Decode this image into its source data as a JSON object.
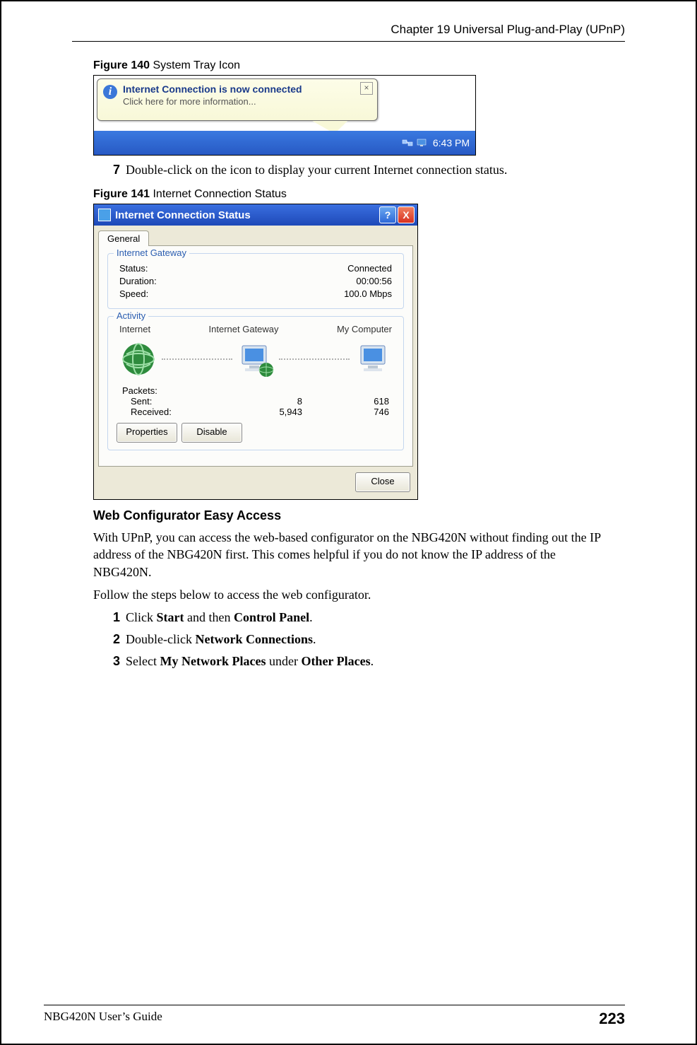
{
  "header": {
    "chapter": "Chapter 19 Universal Plug-and-Play (UPnP)"
  },
  "fig140": {
    "label_num": "Figure 140",
    "label_title": "   System Tray Icon",
    "balloon_title": "Internet Connection is now connected",
    "balloon_sub": "Click here for more information...",
    "clock": "6:43 PM"
  },
  "step7": {
    "num": "7",
    "text": "Double-click on the icon to display your current Internet connection status."
  },
  "fig141": {
    "label_num": "Figure 141",
    "label_title": "   Internet Connection Status",
    "window_title": "Internet Connection Status",
    "tab": "General",
    "group_gateway": "Internet Gateway",
    "status_label": "Status:",
    "status_value": "Connected",
    "duration_label": "Duration:",
    "duration_value": "00:00:56",
    "speed_label": "Speed:",
    "speed_value": "100.0 Mbps",
    "group_activity": "Activity",
    "col_internet": "Internet",
    "col_gateway": "Internet Gateway",
    "col_mycomputer": "My Computer",
    "packets_label": "Packets:",
    "sent_label": "Sent:",
    "received_label": "Received:",
    "sent_gw": "8",
    "sent_pc": "618",
    "recv_gw": "5,943",
    "recv_pc": "746",
    "btn_properties": "Properties",
    "btn_disable": "Disable",
    "btn_close": "Close"
  },
  "section": {
    "heading": "Web Configurator Easy Access",
    "para1": "With UPnP, you can access the web-based configurator on the NBG420N without finding out the IP address of the NBG420N first. This comes helpful if you do not know the IP address of the NBG420N.",
    "para2": "Follow the steps below to access the web configurator."
  },
  "steps": {
    "s1_num": "1",
    "s1_a": "Click ",
    "s1_b": "Start",
    "s1_c": " and then ",
    "s1_d": "Control Panel",
    "s1_e": ".",
    "s2_num": "2",
    "s2_a": "Double-click ",
    "s2_b": "Network Connections",
    "s2_c": ".",
    "s3_num": "3",
    "s3_a": "Select ",
    "s3_b": "My Network Places",
    "s3_c": " under ",
    "s3_d": "Other Places",
    "s3_e": "."
  },
  "footer": {
    "guide": "NBG420N User’s Guide",
    "page": "223"
  }
}
